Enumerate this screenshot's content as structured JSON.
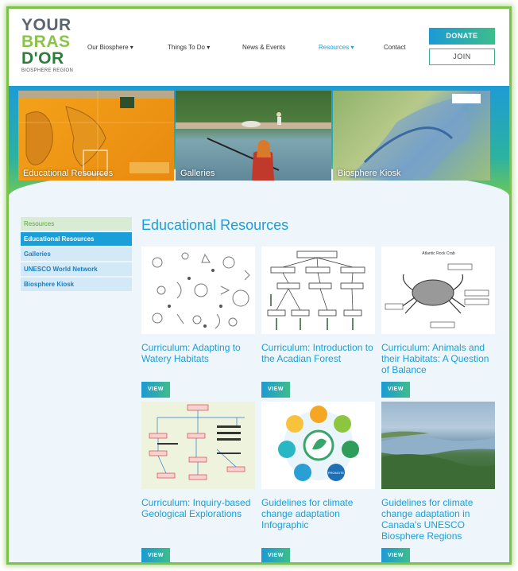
{
  "logo": {
    "line1": "YOUR",
    "line2": "BRAS",
    "line3": "D'OR",
    "tagline": "BIOSPHERE REGION"
  },
  "nav": [
    {
      "label": "Our Biosphere ▾"
    },
    {
      "label": "Things To Do ▾"
    },
    {
      "label": "News & Events"
    },
    {
      "label": "Resources ▾"
    },
    {
      "label": "Contact"
    }
  ],
  "actions": {
    "donate": "DONATE",
    "join": "JOIN"
  },
  "hero": [
    {
      "label": "Educational Resources"
    },
    {
      "label": "Galleries"
    },
    {
      "label": "Biosphere Kiosk"
    }
  ],
  "sidebar": {
    "heading": "Resources",
    "items": [
      {
        "label": "Educational Resources",
        "active": true
      },
      {
        "label": "Galleries"
      },
      {
        "label": "UNESCO World Network"
      },
      {
        "label": "Biosphere Kiosk"
      }
    ]
  },
  "main": {
    "title": "Educational Resources",
    "view_label": "VIEW",
    "cards": [
      {
        "title": "Curriculum: Adapting to Watery Habitats"
      },
      {
        "title": "Curriculum: Introduction to the Acadian Forest"
      },
      {
        "title": "Curriculum: Animals and their Habitats: A Question of Balance"
      },
      {
        "title": "Curriculum: Inquiry-based Geological Explorations"
      },
      {
        "title": "Guidelines for climate change adaptation Infographic"
      },
      {
        "title": "Guidelines for climate change adaptation in Canada's UNESCO Biosphere Regions"
      }
    ],
    "crab_title": "Atlantic Rock Crab",
    "promote_label": "PROMOTE"
  },
  "colors": {
    "accent": "#1a9fd8",
    "green": "#7bc24a",
    "teal": "#3dbd8a"
  }
}
